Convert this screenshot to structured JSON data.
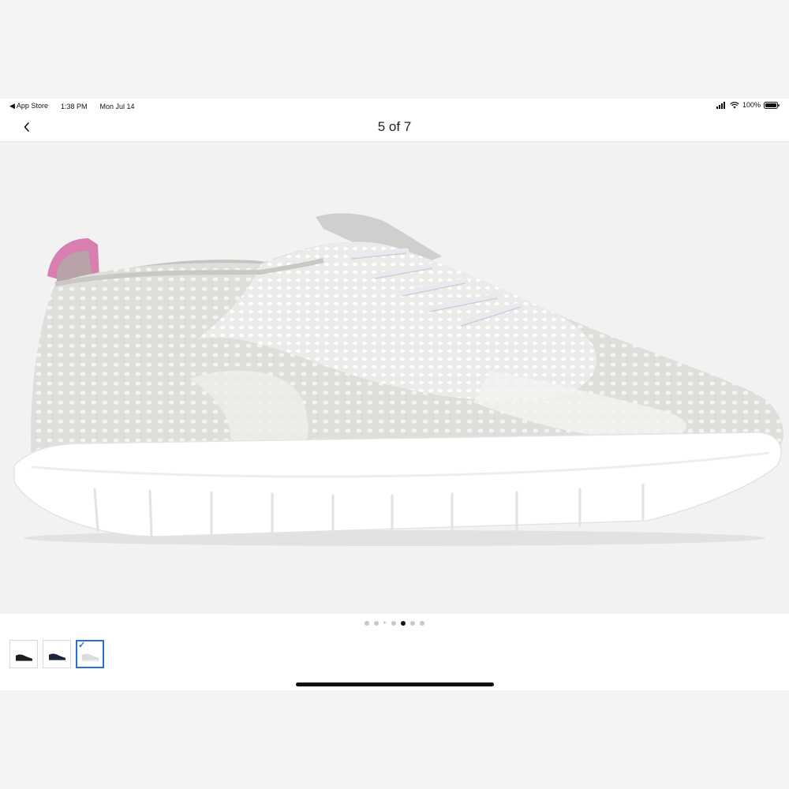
{
  "status_bar": {
    "back_app": "◀ App Store",
    "time": "1:38 PM",
    "date": "Mon Jul 14",
    "battery": "100%"
  },
  "nav": {
    "back_icon": "chevron-left-icon",
    "title": "5 of 7"
  },
  "product_image": {
    "description": "light gray knit wingtip sneaker with white sole and pink heel tab"
  },
  "pager": {
    "total": 7,
    "active_index": 4
  },
  "thumbnails": [
    {
      "color": "black",
      "selected": false
    },
    {
      "color": "navy",
      "selected": false
    },
    {
      "color": "light gray",
      "selected": true
    }
  ],
  "colors": {
    "accent": "#2a6fd6",
    "image_background": "#f2f2f2",
    "heel_pink": "#d67fb0"
  }
}
